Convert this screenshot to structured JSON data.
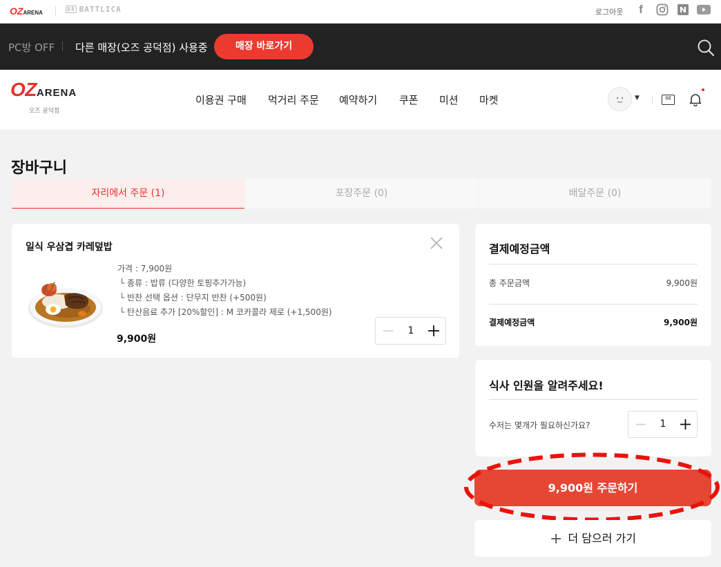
{
  "topbar": {
    "logo_oz": "OZ",
    "logo_arena": "ARENA",
    "battlica_box": "88",
    "battlica": "BATTLICA",
    "logout": "로그아웃",
    "sns": {
      "facebook": "f",
      "naver": "N"
    }
  },
  "notice_bar": {
    "pc_status": "PC방 OFF",
    "store_message": "다른 매장(오즈 공덕점) 사용중",
    "go_store_button": "매장 바로가기"
  },
  "header": {
    "brand_oz": "OZ",
    "brand_arena": "ARENA",
    "branch": "오즈 공덕점",
    "nav": [
      "이용권 구매",
      "먹거리 주문",
      "예약하기",
      "쿠폰",
      "미션",
      "마켓"
    ],
    "oz_icon": "OZ"
  },
  "page": {
    "title": "장바구니",
    "tabs": [
      "자리에서 주문 (1)",
      "포장주문 (0)",
      "배달주문 (0)"
    ],
    "active_tab": 0
  },
  "cart_item": {
    "name": "일식 우삼겹 카레덮밥",
    "price_line": "가격 : 7,900원",
    "options": [
      "└ 종류 : 밥류 (다양한 토핑추가가능)",
      "└ 반찬 선택 옵션 : 단무지 반찬 (+500원)",
      "└ 탄산음료 추가 [20%할인] : M 코카콜라 제로 (+1,500원)"
    ],
    "total": "9,900원",
    "quantity": "1"
  },
  "summary": {
    "title": "결제예정금액",
    "order_amount_label": "총 주문금액",
    "order_amount": "9,900원",
    "payment_label": "결제예정금액",
    "payment_amount": "9,900원"
  },
  "diners": {
    "title": "식사 인원을 알려주세요!",
    "question": "수저는 몇개가 필요하신가요?",
    "quantity": "1"
  },
  "order_button": "9,900원 주문하기",
  "more_button": "더 담으러 가기",
  "colors": {
    "accent": "#e8312a",
    "order_button": "#e64735",
    "highlight": "#e8140c",
    "dark_bar": "#222222"
  }
}
